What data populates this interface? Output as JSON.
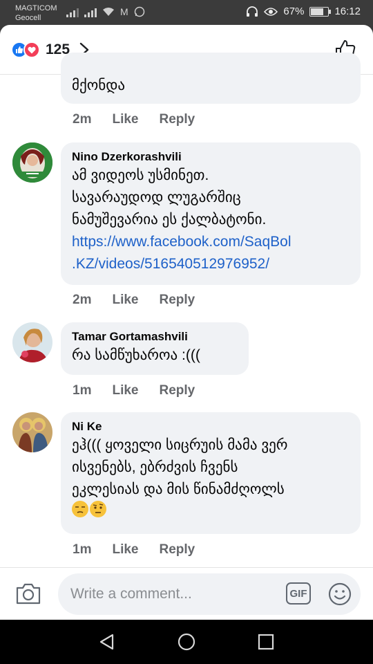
{
  "status": {
    "carrier_line1": "MAGTICOM",
    "carrier_line2": "Geocell",
    "battery_pct": "67%",
    "battery_level": 0.67,
    "time": "16:12"
  },
  "header": {
    "reaction_count": "125",
    "icons": [
      "like-reaction-icon",
      "love-reaction-icon",
      "chevron-right-icon",
      "thumbs-up-outline-icon"
    ]
  },
  "comments": [
    {
      "author": "",
      "text": "მქონდა",
      "time": "2m",
      "like": "Like",
      "reply": "Reply"
    },
    {
      "author": "Nino Dzerkorashvili",
      "text": "ამ ვიდეოს უსმინეთ.\nსავარაუდოდ ლუგარშიც\nნამუშევარია ეს ქალბატონი.",
      "link": "https://www.facebook.com/SaqBol\n.KZ/videos/516540512976952/",
      "time": "2m",
      "like": "Like",
      "reply": "Reply"
    },
    {
      "author": "Tamar Gortamashvili",
      "text": "რა სამწუხაროა :(((",
      "time": "1m",
      "like": "Like",
      "reply": "Reply"
    },
    {
      "author": "Ni Ke",
      "text": "ეჰ((( ყოველი სიცრუის მამა ვერ\nისვენებს, ებრძვის ჩვენს\nეკლესიას და მის წინამძღოლს",
      "time": "1m",
      "like": "Like",
      "reply": "Reply"
    }
  ],
  "composer": {
    "placeholder": "Write a comment...",
    "gif_label": "GIF"
  },
  "colors": {
    "link": "#1e61c9",
    "bubble": "#f0f2f5",
    "like_blue": "#1877f2",
    "love_red": "#f33e58"
  }
}
